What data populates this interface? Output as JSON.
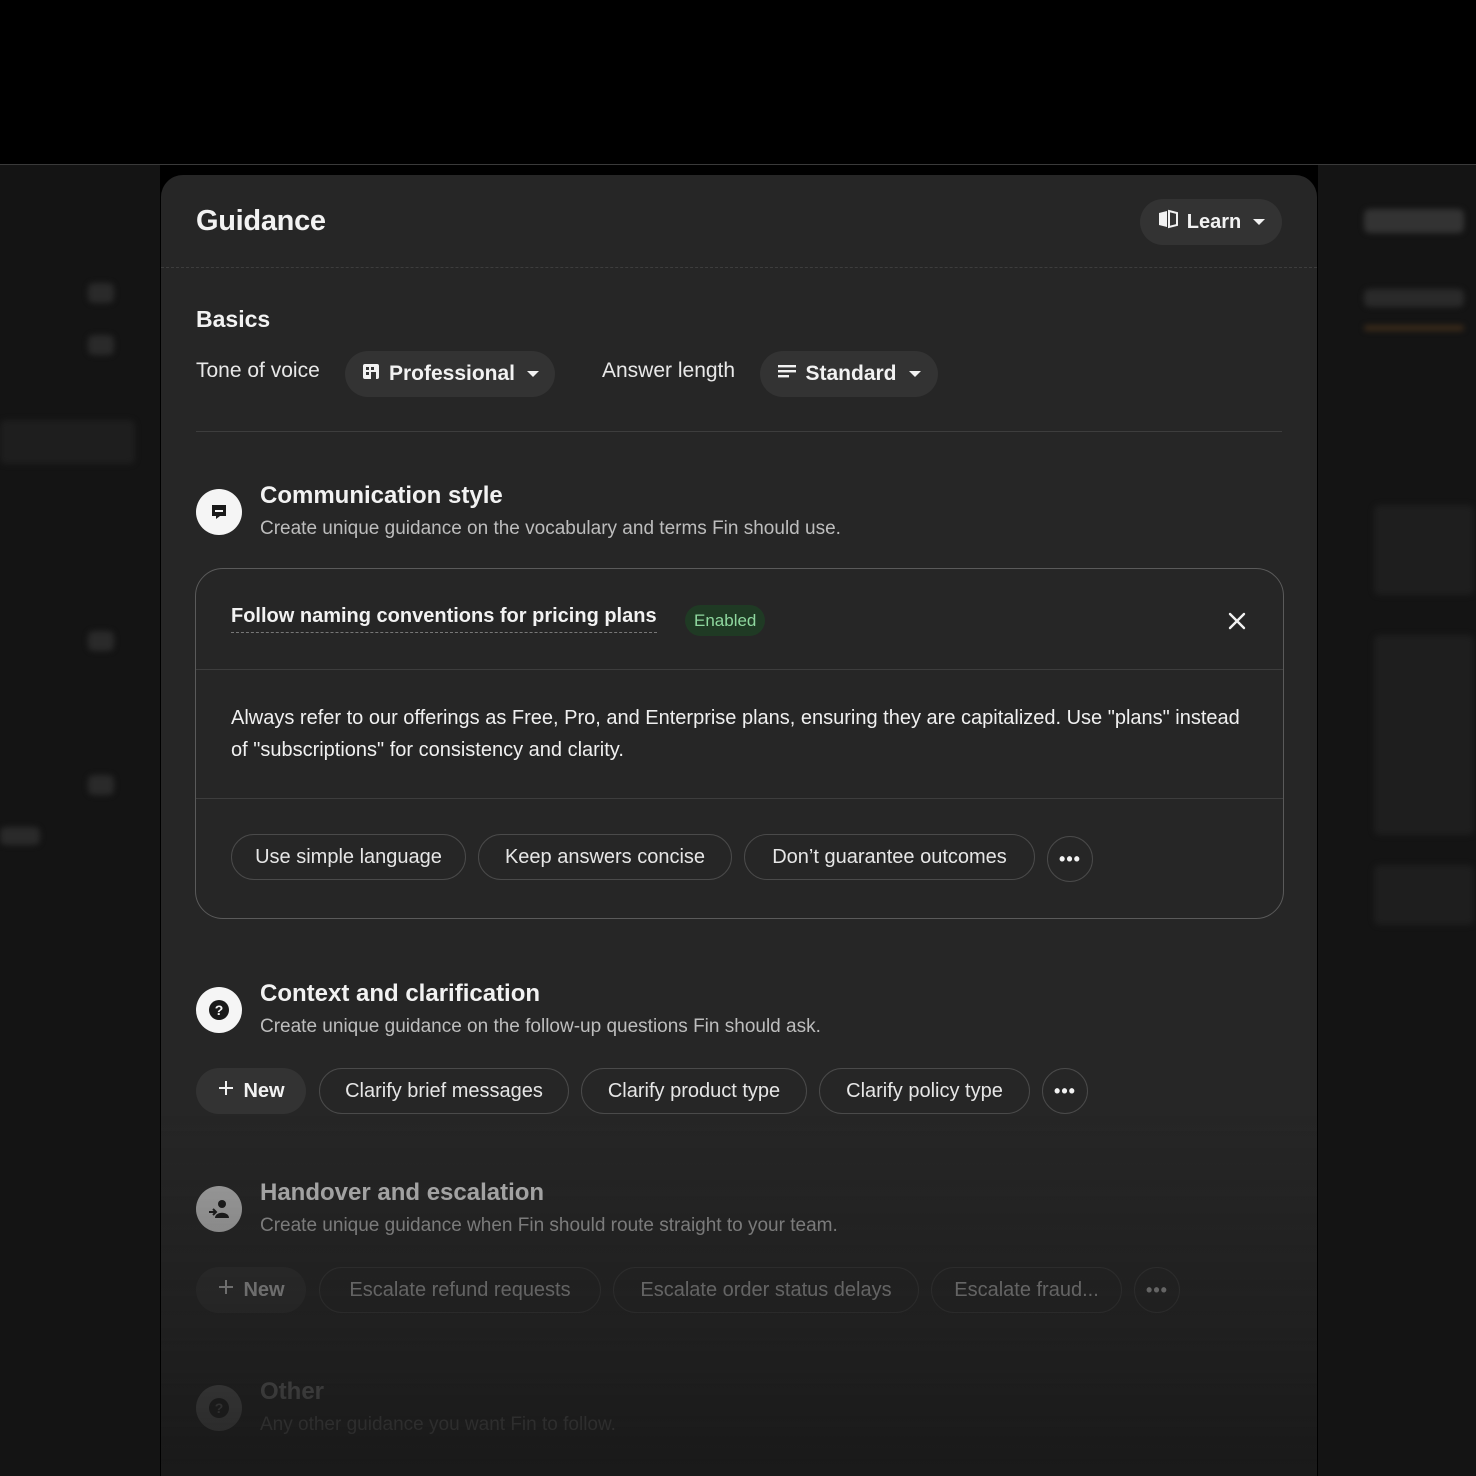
{
  "panel": {
    "title": "Guidance",
    "learn_label": "Learn"
  },
  "basics": {
    "heading": "Basics",
    "tone_label": "Tone of voice",
    "tone_value": "Professional",
    "length_label": "Answer length",
    "length_value": "Standard"
  },
  "communication": {
    "title": "Communication style",
    "description": "Create unique guidance on the vocabulary and terms Fin should use.",
    "card": {
      "title": "Follow naming conventions for pricing plans",
      "status": "Enabled",
      "body": "Always refer to our offerings as Free, Pro, and Enterprise plans, ensuring they are capitalized. Use \"plans\" instead of \"subscriptions\" for consistency and clarity.",
      "chips": [
        "Use simple language",
        "Keep answers concise",
        "Don’t guarantee outcomes"
      ]
    }
  },
  "context": {
    "title": "Context and clarification",
    "description": "Create unique guidance on the follow-up questions Fin should ask.",
    "new_label": "New",
    "chips": [
      "Clarify brief messages",
      "Clarify product type",
      "Clarify policy type"
    ]
  },
  "handover": {
    "title": "Handover and escalation",
    "description": "Create unique guidance when Fin should route straight to your team.",
    "new_label": "New",
    "chips": [
      "Escalate refund requests",
      "Escalate order status delays",
      "Escalate fraud..."
    ]
  },
  "other": {
    "title": "Other",
    "description": "Any other guidance you want Fin to follow."
  },
  "more_label": "•••",
  "colors": {
    "panel": "#262626",
    "background": "#000000",
    "enabled_badge": "#1f3a24",
    "enabled_text": "#8fd89f"
  }
}
